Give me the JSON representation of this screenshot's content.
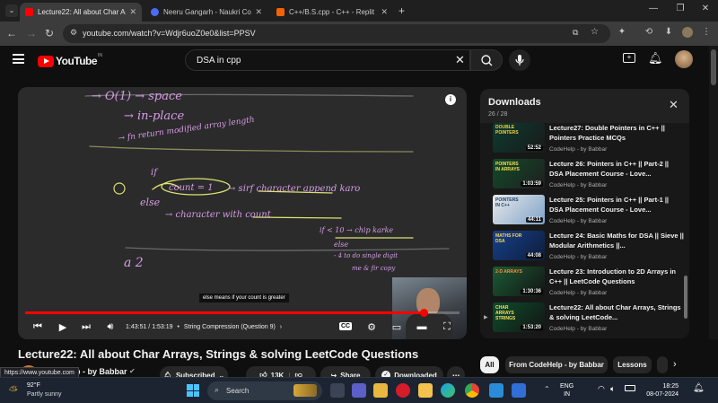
{
  "browser": {
    "tabs": [
      {
        "title": "Lecture22: All about Char Array",
        "active": true
      },
      {
        "title": "Neeru Gangarh - Naukri Code"
      },
      {
        "title": "C++/B.S.cpp - C++ - Replit"
      }
    ],
    "url": "youtube.com/watch?v=Wdjr6uoZ0e0&list=PPSV"
  },
  "youtube": {
    "logo": "YouTube",
    "logo_badge": "IN",
    "search_value": "DSA in cpp"
  },
  "player": {
    "caption": "else means if your count is greater",
    "time": "1:43:51 / 1:53:19",
    "chapter": "String Compression (Question 9)",
    "progress": 0.917,
    "cc_label": "CC",
    "notes": [
      "→ O(1) → space",
      "→ in-place",
      "→ fn return modified array length",
      "if",
      "count = 1",
      "→ sirf character append karo",
      "else",
      "→ character with count",
      "if < 10 → chip karke",
      "else",
      "- 4 to do single digit",
      "me & fir copy",
      "a 2"
    ]
  },
  "video": {
    "title": "Lecture22: All about Char Arrays, Strings & solving LeetCode Questions",
    "channel": "p - by Babbar",
    "subscribed_label": "Subscribed",
    "likes": "13K",
    "share_label": "Share",
    "downloaded_label": "Downloaded",
    "link_tooltip": "https://www.youtube.com"
  },
  "downloads": {
    "title": "Downloads",
    "count": "26 / 28",
    "items": [
      {
        "title": "Lecture27: Double Pointers in C++ || Pointers Practice MCQs",
        "channel": "CodeHelp - by Babbar",
        "duration": "52:52",
        "thumb_text": "DOUBLE POINTERS"
      },
      {
        "title": "Lecture 26: Pointers in C++ || Part-2 || DSA Placement Course - Love...",
        "channel": "CodeHelp - by Babbar",
        "duration": "1:03:59",
        "thumb_text": "POINTERS IN ARRAYS"
      },
      {
        "title": "Lecture 25: Pointers in C++ || Part-1 || DSA Placement Course - Love...",
        "channel": "CodeHelp - by Babbar",
        "duration": "44:11",
        "thumb_text": "POINTERS IN C++"
      },
      {
        "title": "Lecture 24: Basic Maths for DSA || Sieve || Modular Arithmetics ||...",
        "channel": "CodeHelp - by Babbar",
        "duration": "44:08",
        "thumb_text": "MATHS FOR DSA"
      },
      {
        "title": "Lecture 23: Introduction to 2D Arrays in C++ || LeetCode Questions",
        "channel": "CodeHelp - by Babbar",
        "duration": "1:30:36",
        "thumb_text": "2-D ARRAYS"
      },
      {
        "title": "Lecture22: All about Char Arrays, Strings & solving LeetCode...",
        "channel": "CodeHelp - by Babbar",
        "duration": "1:53:20",
        "thumb_text": "CHAR ARRAYS STRINGS",
        "playing": true
      }
    ]
  },
  "chips": [
    "All",
    "From CodeHelp - by Babbar",
    "Lessons"
  ],
  "taskbar": {
    "weather_temp": "92°F",
    "weather_desc": "Partly sunny",
    "search_label": "Search",
    "lang": "ENG",
    "region": "IN",
    "time": "18:25",
    "date": "08-07-2024"
  }
}
